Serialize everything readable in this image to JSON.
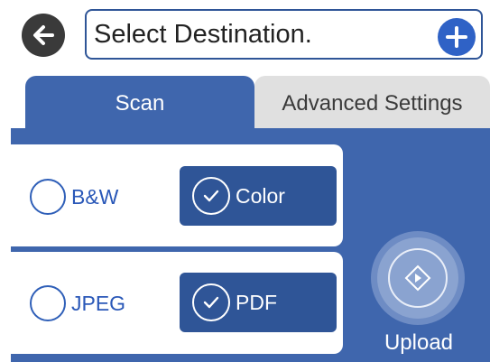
{
  "header": {
    "back_icon": "arrow-left-icon",
    "destination_placeholder": "Select Destination.",
    "add_icon": "plus-icon"
  },
  "tabs": [
    {
      "label": "Scan",
      "active": true
    },
    {
      "label": "Advanced Settings",
      "active": false
    }
  ],
  "color_mode": {
    "options": [
      {
        "label": "B&W",
        "selected": false
      },
      {
        "label": "Color",
        "selected": true
      }
    ]
  },
  "file_format": {
    "options": [
      {
        "label": "JPEG",
        "selected": false
      },
      {
        "label": "PDF",
        "selected": true
      }
    ]
  },
  "action": {
    "upload_label": "Upload",
    "upload_icon": "diamond-start-icon",
    "enabled": false
  },
  "colors": {
    "primary_blue": "#3f66ad",
    "button_blue": "#2f5597",
    "inactive_tab": "#e0e0e0",
    "accent": "#2f62c6"
  }
}
